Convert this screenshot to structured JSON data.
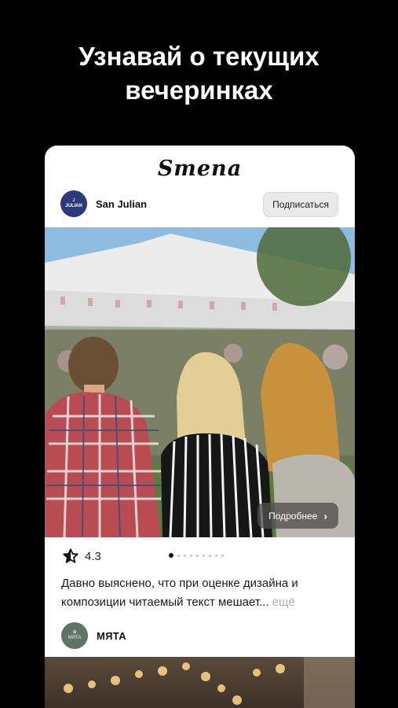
{
  "headline": {
    "line1": "Узнавай о текущих",
    "line2": "вечеринках"
  },
  "brand": "Smena",
  "post1": {
    "venue_name": "San Julian",
    "avatar_text": "JULIAN",
    "subscribe_label": "Подписаться",
    "details_label": "Подробнее",
    "rating": "4.3",
    "slides_total": 9,
    "slide_active": 1,
    "description": "Давно выяснено, что при оценке дизайна и композиции читаемый текст мешает...",
    "more_label": "ещё"
  },
  "post2": {
    "venue_name": "МЯТА",
    "avatar_text": "МЯТА"
  },
  "colors": {
    "background": "#000000",
    "card": "#ffffff",
    "san_julian_avatar": "#2c3a7c",
    "myata_avatar": "#5f7366"
  }
}
